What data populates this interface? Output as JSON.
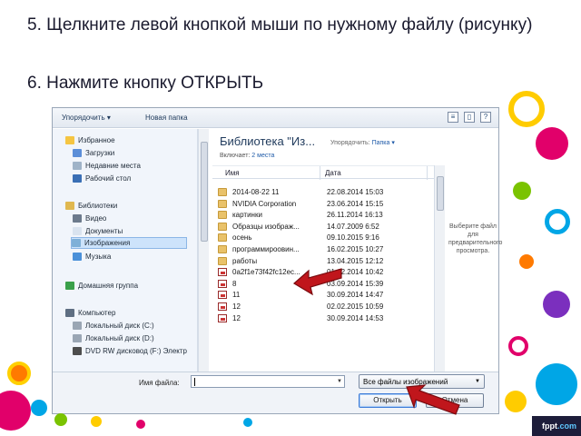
{
  "instructions": {
    "step5": "5. Щелкните левой кнопкой мыши по нужному файлу (рисунку)",
    "step6": "6. Нажмите кнопку ОТКРЫТЬ"
  },
  "toolbar": {
    "organize": "Упорядочить ▾",
    "new_folder": "Новая папка"
  },
  "nav": {
    "favorites": "Избранное",
    "downloads": "Загрузки",
    "recent": "Недавние места",
    "desktop": "Рабочий стол",
    "libraries": "Библиотеки",
    "video": "Видео",
    "documents": "Документы",
    "images": "Изображения",
    "music": "Музыка",
    "homegroup": "Домашняя группа",
    "computer": "Компьютер",
    "disk_c": "Локальный диск (C:)",
    "disk_d": "Локальный диск (D:)",
    "dvd": "DVD RW дисковод (F:) Электр"
  },
  "library": {
    "title": "Библиотека \"Из...",
    "includes_label": "Включает:",
    "includes_value": "2 места",
    "arrange_label": "Упорядочить:",
    "arrange_value": "Папка ▾"
  },
  "columns": {
    "name": "Имя",
    "date": "Дата"
  },
  "files": [
    {
      "name": "2014-08-22 11",
      "date": "22.08.2014 15:03",
      "type": "folder"
    },
    {
      "name": "NVIDIA Corporation",
      "date": "23.06.2014 15:15",
      "type": "folder"
    },
    {
      "name": "картинки",
      "date": "26.11.2014 16:13",
      "type": "folder"
    },
    {
      "name": "Образцы изображ...",
      "date": "14.07.2009 6:52",
      "type": "folder"
    },
    {
      "name": "осень",
      "date": "09.10.2015 9:16",
      "type": "folder"
    },
    {
      "name": "программироовин...",
      "date": "16.02.2015 10:27",
      "type": "folder"
    },
    {
      "name": "работы",
      "date": "13.04.2015 12:12",
      "type": "folder"
    },
    {
      "name": "0a2f1e73f42fc12ec...",
      "date": "01.12.2014 10:42",
      "type": "image"
    },
    {
      "name": "8",
      "date": "03.09.2014 15:39",
      "type": "image"
    },
    {
      "name": "11",
      "date": "30.09.2014 14:47",
      "type": "image"
    },
    {
      "name": "12",
      "date": "02.02.2015 10:59",
      "type": "image"
    },
    {
      "name": "12",
      "date": "30.09.2014 14:53",
      "type": "image"
    }
  ],
  "preview_text": "Выберите файл для предварительного просмотра.",
  "bottom": {
    "filename_label": "Имя файла:",
    "filename_value": "",
    "filetype": "Все файлы изображений",
    "open": "Открыть",
    "cancel": "Отмена"
  },
  "brand": {
    "name": "fppt",
    "suffix": ".com"
  },
  "colors": {
    "arrow": "#c0161c",
    "selection": "#cde3fb",
    "link": "#1e5aa8"
  }
}
